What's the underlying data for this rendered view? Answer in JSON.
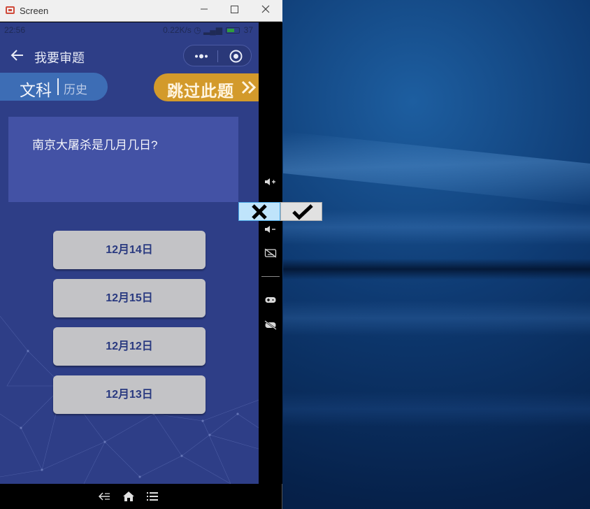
{
  "window": {
    "title": "Screen"
  },
  "status_bar": {
    "time": "22:56",
    "info": "0.22K/s",
    "battery": "37"
  },
  "navbar": {
    "title": "我要审题"
  },
  "subject": {
    "main": "文科",
    "sub": "历史"
  },
  "skip": {
    "label": "跳过此题"
  },
  "question": {
    "text": "南京大屠杀是几月几日?"
  },
  "options": [
    {
      "label": "12月14日"
    },
    {
      "label": "12月15日"
    },
    {
      "label": "12月12日"
    },
    {
      "label": "12月13日"
    }
  ],
  "colors": {
    "phone_bg": "#2e3e87",
    "skip_accent": "#d39a2b",
    "subject_pill": "#3d6db5",
    "card": "#4352a5"
  }
}
